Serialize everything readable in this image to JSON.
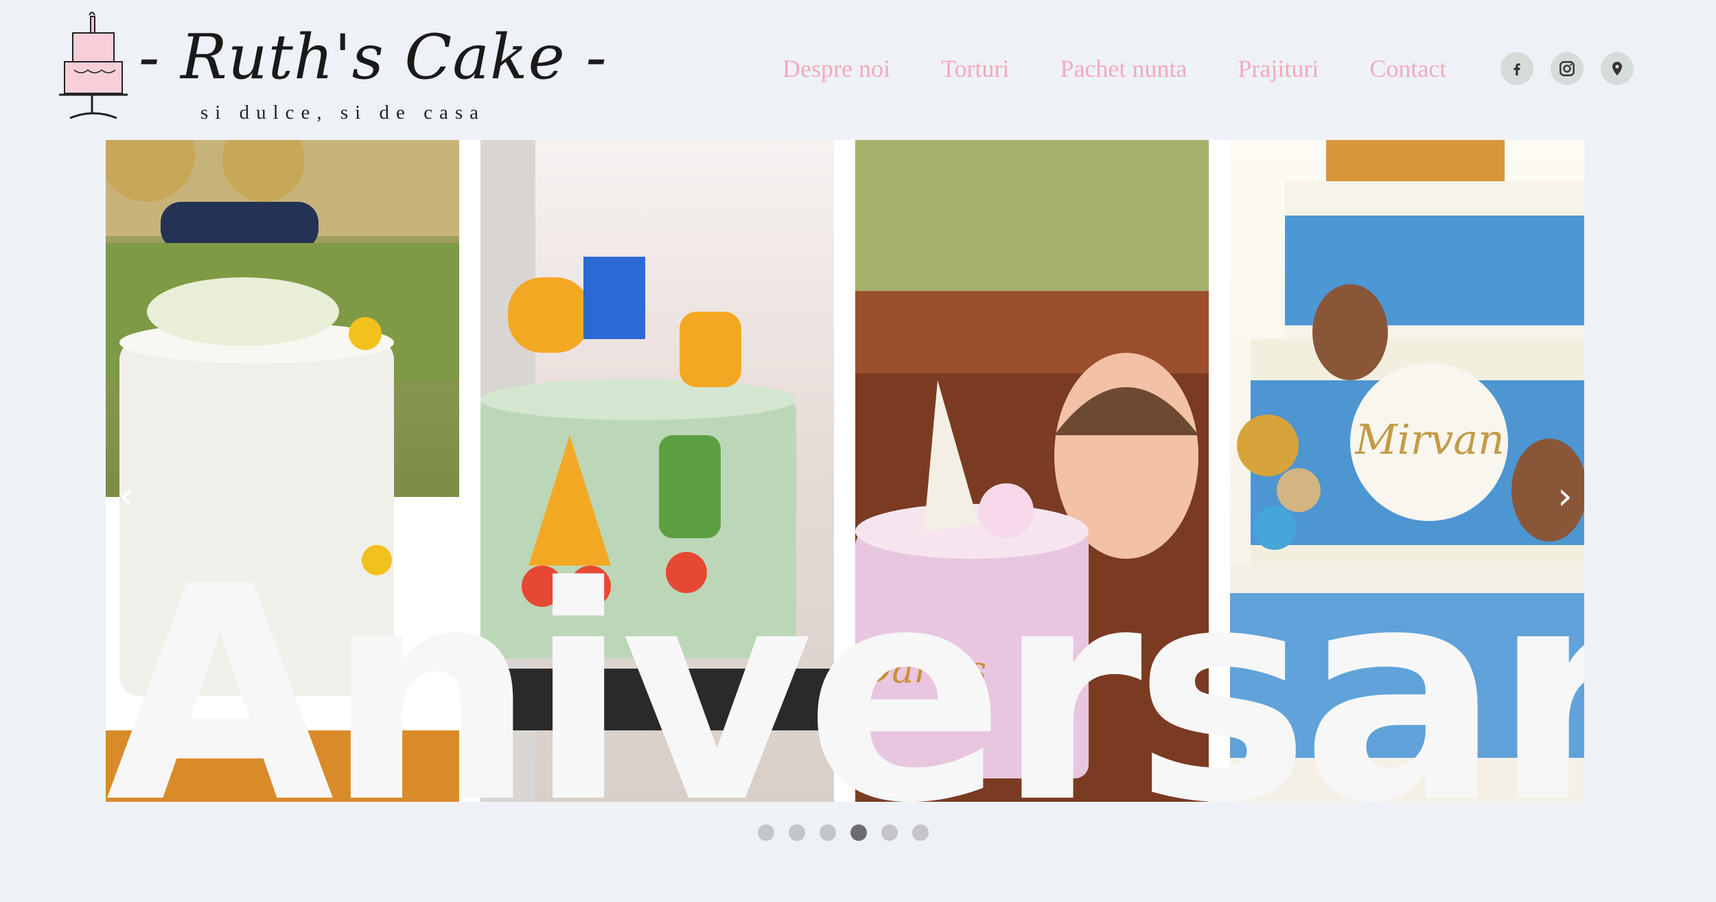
{
  "brand": {
    "name": "- Ruth's Cake -",
    "tagline": "si dulce, si de casa"
  },
  "nav": {
    "items": [
      {
        "label": "Despre noi"
      },
      {
        "label": "Torturi"
      },
      {
        "label": "Pachet nunta"
      },
      {
        "label": "Prajituri"
      },
      {
        "label": "Contact"
      }
    ]
  },
  "social": {
    "icons": [
      "facebook-icon",
      "instagram-icon",
      "location-pin-icon"
    ]
  },
  "slider": {
    "title": "Aniversari",
    "prev_arrow": "‹",
    "next_arrow": "›",
    "cake_names": [
      "Darius",
      "Mirvan"
    ],
    "dot_count": 6,
    "active_dot": 4
  },
  "colors": {
    "nav_text": "#f4a9bd",
    "background": "#eef2f6",
    "social_bg": "#d6dcd8",
    "dot": "#c4c5c8",
    "dot_active": "#6d6d70"
  }
}
